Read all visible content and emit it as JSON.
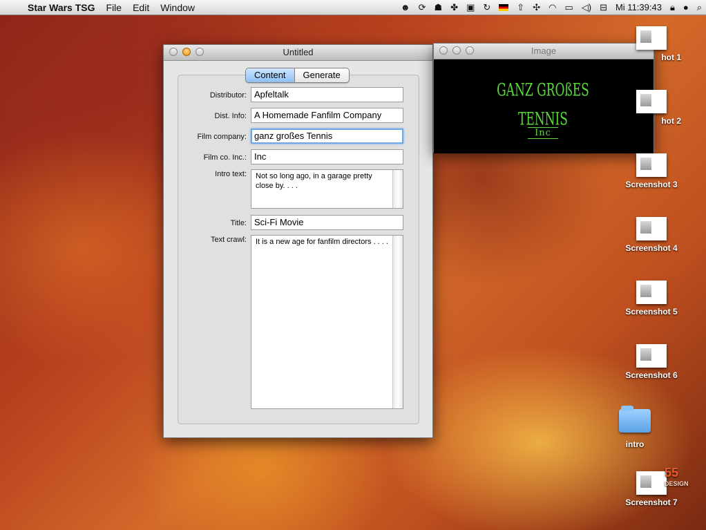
{
  "menubar": {
    "app_name": "Star Wars TSG",
    "menus": [
      "File",
      "Edit",
      "Window"
    ],
    "clock": "Mi 11:39:43"
  },
  "main_window": {
    "title": "Untitled",
    "tabs": [
      {
        "label": "Content",
        "active": true
      },
      {
        "label": "Generate",
        "active": false
      }
    ],
    "fields": {
      "distributor": {
        "label": "Distributor:",
        "value": "Apfeltalk"
      },
      "dist_info": {
        "label": "Dist. Info:",
        "value": "A Homemade Fanfilm Company"
      },
      "film_company": {
        "label": "Film company:",
        "value": "ganz großes Tennis"
      },
      "film_co_inc": {
        "label": "Film co. Inc.:",
        "value": "Inc"
      },
      "intro_text": {
        "label": "Intro text:",
        "value": "Not so long ago, in a garage pretty close by. . . ."
      },
      "title": {
        "label": "Title:",
        "value": "Sci-Fi Movie"
      },
      "text_crawl": {
        "label": "Text crawl:",
        "value": "It is a new age for fanfilm directors . . . ."
      }
    }
  },
  "image_window": {
    "title": "Image",
    "logo_main": "GANZ GROßES TENNIS",
    "logo_sub": "Inc"
  },
  "desktop": {
    "icons": [
      {
        "label": "Screenshot 1",
        "display": "hot 1"
      },
      {
        "label": "Screenshot 2",
        "display": "hot 2"
      },
      {
        "label": "Screenshot 3",
        "display": "Screenshot 3"
      },
      {
        "label": "Screenshot 4",
        "display": "Screenshot 4"
      },
      {
        "label": "Screenshot 5",
        "display": "Screenshot 5"
      },
      {
        "label": "Screenshot 6",
        "display": "Screenshot 6"
      },
      {
        "label": "intro",
        "display": "intro"
      },
      {
        "label": "Screenshot 7",
        "display": "Screenshot 7"
      }
    ],
    "brand_top": "55",
    "brand_bottom": "DESIGN"
  },
  "colors": {
    "accent": "#8cc0f5",
    "logo_green": "#5cd93a"
  }
}
